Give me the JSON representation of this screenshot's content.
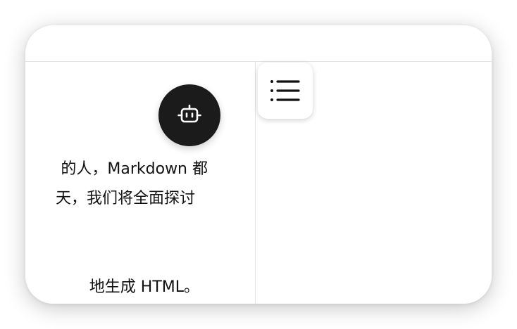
{
  "window": {
    "background": "#ffffff",
    "divider_color": "#e4e4e4"
  },
  "document": {
    "lines": [
      "的人，Markdown 都",
      "天，我们将全面探讨",
      "地生成 HTML。"
    ]
  },
  "assistant_button": {
    "icon": "robot-icon",
    "background": "#1b1b1b"
  },
  "toc_button": {
    "icon": "list-icon"
  }
}
